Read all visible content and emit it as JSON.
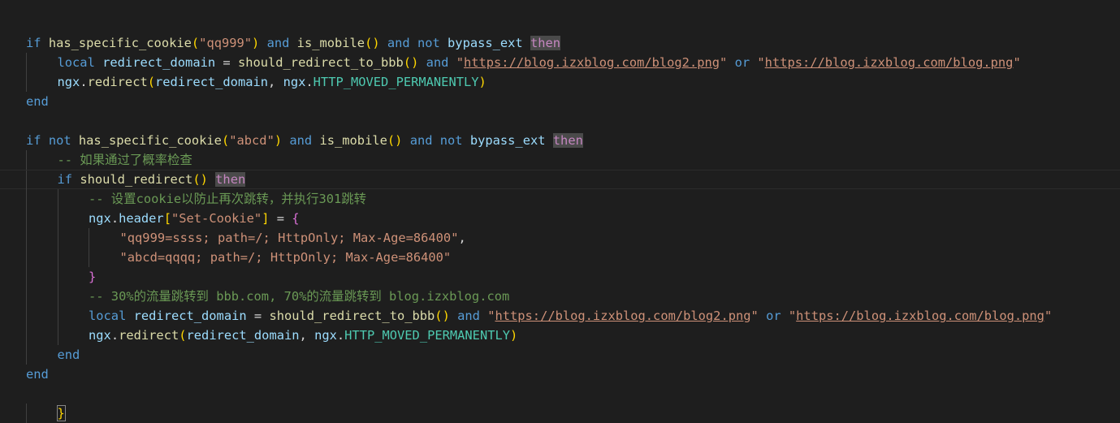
{
  "editor": {
    "lines": [
      {
        "indent": 0,
        "tokens": [
          {
            "t": "if",
            "c": "k"
          },
          {
            "t": " ",
            "c": "p"
          },
          {
            "t": "has_specific_cookie",
            "c": "f"
          },
          {
            "t": "(",
            "c": "b1"
          },
          {
            "t": "\"qq999\"",
            "c": "s"
          },
          {
            "t": ")",
            "c": "b1"
          },
          {
            "t": " and ",
            "c": "k"
          },
          {
            "t": "is_mobile",
            "c": "f"
          },
          {
            "t": "()",
            "c": "b1"
          },
          {
            "t": " and not ",
            "c": "k"
          },
          {
            "t": "bypass_ext",
            "c": "v"
          },
          {
            "t": " ",
            "c": "p"
          },
          {
            "t": "then",
            "c": "c",
            "hl": true
          }
        ]
      },
      {
        "indent": 1,
        "tokens": [
          {
            "t": "local",
            "c": "k"
          },
          {
            "t": " ",
            "c": "p"
          },
          {
            "t": "redirect_domain",
            "c": "v"
          },
          {
            "t": " = ",
            "c": "p"
          },
          {
            "t": "should_redirect_to_bbb",
            "c": "f"
          },
          {
            "t": "()",
            "c": "b1"
          },
          {
            "t": " and ",
            "c": "k"
          },
          {
            "t": "\"",
            "c": "s"
          },
          {
            "t": "https://blog.izxblog.com/blog2.png",
            "c": "url"
          },
          {
            "t": "\"",
            "c": "s"
          },
          {
            "t": " or ",
            "c": "k"
          },
          {
            "t": "\"",
            "c": "s"
          },
          {
            "t": "https://blog.izxblog.com/blog.png",
            "c": "url"
          },
          {
            "t": "\"",
            "c": "s"
          }
        ]
      },
      {
        "indent": 1,
        "tokens": [
          {
            "t": "ngx",
            "c": "v"
          },
          {
            "t": ".",
            "c": "p"
          },
          {
            "t": "redirect",
            "c": "f"
          },
          {
            "t": "(",
            "c": "b1"
          },
          {
            "t": "redirect_domain",
            "c": "v"
          },
          {
            "t": ", ",
            "c": "p"
          },
          {
            "t": "ngx",
            "c": "v"
          },
          {
            "t": ".",
            "c": "p"
          },
          {
            "t": "HTTP_MOVED_PERMANENTLY",
            "c": "n"
          },
          {
            "t": ")",
            "c": "b1"
          }
        ]
      },
      {
        "indent": 0,
        "tokens": [
          {
            "t": "end",
            "c": "k"
          }
        ]
      },
      {
        "indent": 0,
        "tokens": []
      },
      {
        "indent": 0,
        "tokens": [
          {
            "t": "if",
            "c": "k"
          },
          {
            "t": " not ",
            "c": "k"
          },
          {
            "t": "has_specific_cookie",
            "c": "f"
          },
          {
            "t": "(",
            "c": "b1"
          },
          {
            "t": "\"abcd\"",
            "c": "s"
          },
          {
            "t": ")",
            "c": "b1"
          },
          {
            "t": " and ",
            "c": "k"
          },
          {
            "t": "is_mobile",
            "c": "f"
          },
          {
            "t": "()",
            "c": "b1"
          },
          {
            "t": " and not ",
            "c": "k"
          },
          {
            "t": "bypass_ext",
            "c": "v"
          },
          {
            "t": " ",
            "c": "p"
          },
          {
            "t": "then",
            "c": "c",
            "hl": true
          }
        ]
      },
      {
        "indent": 1,
        "tokens": [
          {
            "t": "-- 如果通过了概率检查",
            "c": "cm"
          }
        ]
      },
      {
        "indent": 1,
        "current": true,
        "tokens": [
          {
            "t": "if",
            "c": "k"
          },
          {
            "t": " ",
            "c": "p"
          },
          {
            "t": "should_redirect",
            "c": "f"
          },
          {
            "t": "()",
            "c": "b1"
          },
          {
            "t": " ",
            "c": "p"
          },
          {
            "t": "then",
            "c": "c",
            "hl": true
          }
        ]
      },
      {
        "indent": 2,
        "tokens": [
          {
            "t": "-- 设置cookie以防止再次跳转，并执行301跳转",
            "c": "cm"
          }
        ]
      },
      {
        "indent": 2,
        "tokens": [
          {
            "t": "ngx",
            "c": "v"
          },
          {
            "t": ".",
            "c": "p"
          },
          {
            "t": "header",
            "c": "v"
          },
          {
            "t": "[",
            "c": "b1"
          },
          {
            "t": "\"Set-Cookie\"",
            "c": "s"
          },
          {
            "t": "]",
            "c": "b1"
          },
          {
            "t": " = ",
            "c": "p"
          },
          {
            "t": "{",
            "c": "b2"
          }
        ]
      },
      {
        "indent": 3,
        "tokens": [
          {
            "t": "\"qq999=ssss; path=/; HttpOnly; Max-Age=86400\"",
            "c": "s"
          },
          {
            "t": ",",
            "c": "p"
          }
        ]
      },
      {
        "indent": 3,
        "tokens": [
          {
            "t": "\"abcd=qqqq; path=/; HttpOnly; Max-Age=86400\"",
            "c": "s"
          }
        ]
      },
      {
        "indent": 2,
        "tokens": [
          {
            "t": "}",
            "c": "b2"
          }
        ]
      },
      {
        "indent": 2,
        "tokens": [
          {
            "t": "-- 30%的流量跳转到 bbb.com, 70%的流量跳转到 blog.izxblog.com",
            "c": "cm"
          }
        ]
      },
      {
        "indent": 2,
        "tokens": [
          {
            "t": "local",
            "c": "k"
          },
          {
            "t": " ",
            "c": "p"
          },
          {
            "t": "redirect_domain",
            "c": "v"
          },
          {
            "t": " = ",
            "c": "p"
          },
          {
            "t": "should_redirect_to_bbb",
            "c": "f"
          },
          {
            "t": "()",
            "c": "b1"
          },
          {
            "t": " and ",
            "c": "k"
          },
          {
            "t": "\"",
            "c": "s"
          },
          {
            "t": "https://blog.izxblog.com/blog2.png",
            "c": "url"
          },
          {
            "t": "\"",
            "c": "s"
          },
          {
            "t": " or ",
            "c": "k"
          },
          {
            "t": "\"",
            "c": "s"
          },
          {
            "t": "https://blog.izxblog.com/blog.png",
            "c": "url"
          },
          {
            "t": "\"",
            "c": "s"
          }
        ]
      },
      {
        "indent": 2,
        "tokens": [
          {
            "t": "ngx",
            "c": "v"
          },
          {
            "t": ".",
            "c": "p"
          },
          {
            "t": "redirect",
            "c": "f"
          },
          {
            "t": "(",
            "c": "b1"
          },
          {
            "t": "redirect_domain",
            "c": "v"
          },
          {
            "t": ", ",
            "c": "p"
          },
          {
            "t": "ngx",
            "c": "v"
          },
          {
            "t": ".",
            "c": "p"
          },
          {
            "t": "HTTP_MOVED_PERMANENTLY",
            "c": "n"
          },
          {
            "t": ")",
            "c": "b1"
          }
        ]
      },
      {
        "indent": 1,
        "tokens": [
          {
            "t": "end",
            "c": "k"
          }
        ]
      },
      {
        "indent": 0,
        "tokens": [
          {
            "t": "end",
            "c": "k"
          }
        ]
      },
      {
        "indent": 0,
        "tokens": []
      },
      {
        "indent": 1,
        "tokens": [
          {
            "t": "}",
            "c": "b1",
            "box": true
          }
        ]
      }
    ]
  }
}
